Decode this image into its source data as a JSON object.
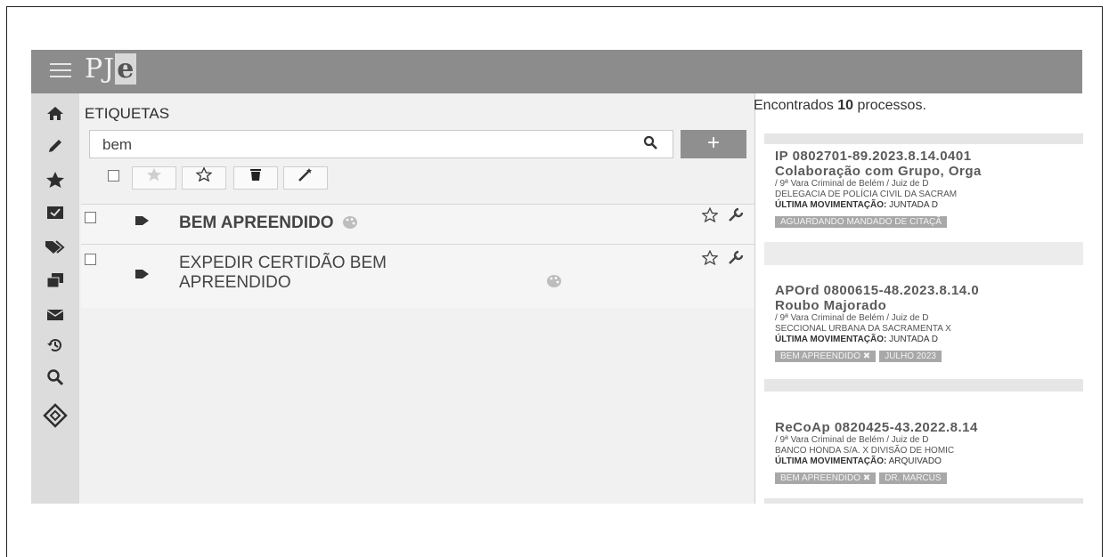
{
  "app": {
    "logo": "PJe",
    "logo_main": "PJ",
    "logo_accent": "e"
  },
  "nav_icons": [
    "home-icon",
    "pencil-icon",
    "star-icon",
    "inbox-check-icon",
    "tags-icon",
    "clone-icon",
    "envelope-icon",
    "history-icon",
    "search-icon",
    "diamond-logo-icon"
  ],
  "panel": {
    "title": "ETIQUETAS",
    "search_value": "bem",
    "search_button": "⌕",
    "add_button": "+",
    "toolbar_icons": [
      "star-filled-icon",
      "star-outline-icon",
      "trash-icon",
      "magic-wand-icon"
    ]
  },
  "tags": [
    {
      "label": "BEM APREENDIDO",
      "bold": true
    },
    {
      "label_line1": "EXPEDIR CERTIDÃO BEM",
      "label_line2": "APREENDIDO",
      "bold": false
    }
  ],
  "results": {
    "found_prefix": "Encontrados ",
    "found_count": "10",
    "found_suffix": " processos.",
    "cards": [
      {
        "number": "IP 0802701-89.2023.8.14.0401",
        "subject": "Colaboração com Grupo, Orga",
        "court": "/ 9ª Vara Criminal de Belém / Juiz de D",
        "parties": "DELEGACIA DE POLÍCIA CIVIL DA SACRAM",
        "movement_label": "ÚLTIMA MOVIMENTAÇÃO:",
        "movement_value": " JUNTADA D",
        "chips": [
          "AGUARDANDO MANDADO DE CITAÇÃ"
        ]
      },
      {
        "number": "APOrd 0800615-48.2023.8.14.0",
        "subject": "Roubo Majorado",
        "court": "/ 9ª Vara Criminal de Belém / Juiz de D",
        "parties": "SECCIONAL URBANA DA SACRAMENTA X",
        "movement_label": "ÚLTIMA MOVIMENTAÇÃO:",
        "movement_value": " JUNTADA D",
        "chips": [
          "BEM APREENDIDO ✖",
          "JULHO 2023"
        ]
      },
      {
        "number": "ReCoAp 0820425-43.2022.8.14",
        "subject": "",
        "court": "/ 9ª Vara Criminal de Belém / Juiz de D",
        "parties": "BANCO HONDA S/A. X DIVISÃO DE HOMIC",
        "movement_label": "ÚLTIMA MOVIMENTAÇÃO:",
        "movement_value": " ARQUIVADO",
        "chips": [
          "BEM APREENDIDO ✖",
          "DR. MARCUS"
        ]
      }
    ]
  }
}
